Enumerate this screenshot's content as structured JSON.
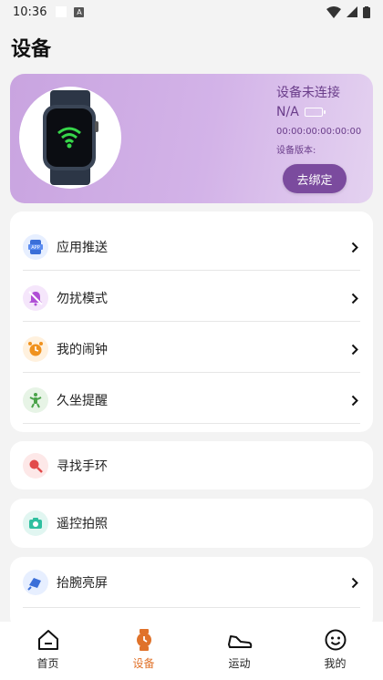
{
  "status_bar": {
    "time": "10:36",
    "a_badge": "A"
  },
  "page": {
    "title": "设备"
  },
  "device": {
    "connection_status": "设备未连接",
    "battery_text": "N/A",
    "mac": "00:00:00:00:00:00",
    "version_label": "设备版本:",
    "unbind_label": "去绑定",
    "card_gradient": [
      "#c9a4e0",
      "#e4d2f0"
    ],
    "accent": "#7b4b9e"
  },
  "menu_group_1": [
    {
      "label": "应用推送",
      "icon": "app-push-icon",
      "icon_color": "#3b6fd8",
      "bg": "#e7efff"
    },
    {
      "label": "勿扰模式",
      "icon": "do-not-disturb-icon",
      "icon_color": "#b04fd6",
      "bg": "#f5e6fb"
    },
    {
      "label": "我的闹钟",
      "icon": "alarm-clock-icon",
      "icon_color": "#f0921e",
      "bg": "#fff1de"
    },
    {
      "label": "久坐提醒",
      "icon": "sedentary-reminder-icon",
      "icon_color": "#4aa34a",
      "bg": "#e7f4e6"
    }
  ],
  "menu_find": {
    "label": "寻找手环",
    "icon": "find-band-icon",
    "icon_color": "#e24a4a",
    "bg": "#fde8e8"
  },
  "menu_camera": {
    "label": "遥控拍照",
    "icon": "remote-camera-icon",
    "icon_color": "#2fbf9f",
    "bg": "#e1f6f1"
  },
  "menu_raise": {
    "label": "抬腕亮屏",
    "icon": "raise-wrist-icon",
    "icon_color": "#3b6fd8",
    "bg": "#e7efff"
  },
  "bottom_nav": [
    {
      "label": "首页",
      "icon": "home-icon",
      "active": false
    },
    {
      "label": "设备",
      "icon": "watch-icon",
      "active": true
    },
    {
      "label": "运动",
      "icon": "sneaker-icon",
      "active": false
    },
    {
      "label": "我的",
      "icon": "smiley-icon",
      "active": false
    }
  ]
}
